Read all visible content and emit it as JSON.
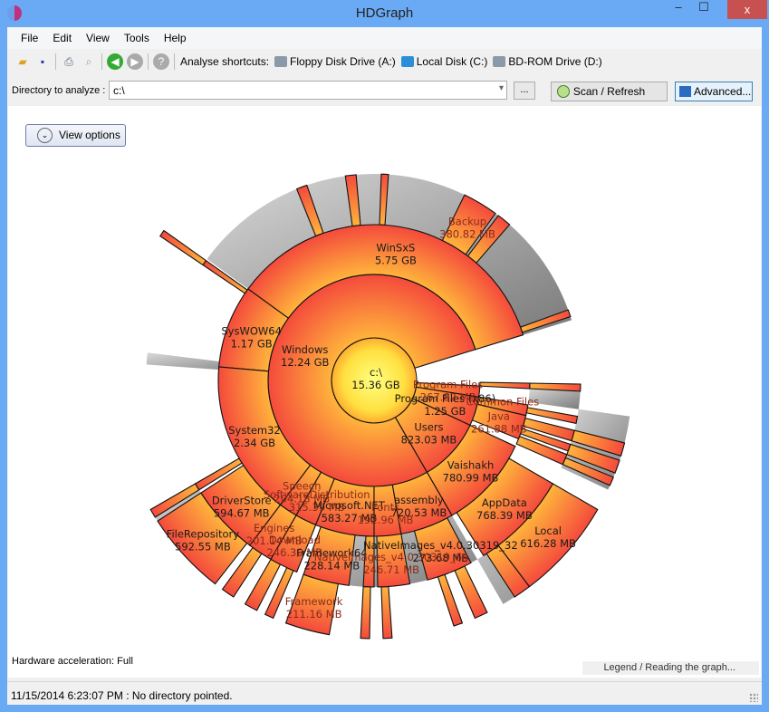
{
  "window": {
    "title": "HDGraph",
    "minimize": "‒",
    "maximize": "☐",
    "close": "x"
  },
  "menu": [
    "File",
    "Edit",
    "View",
    "Tools",
    "Help"
  ],
  "toolbar": {
    "icons": [
      "open-folder-icon",
      "save-icon",
      "print-icon",
      "print-preview-icon",
      "back-icon",
      "forward-icon",
      "help-icon"
    ],
    "shortcuts_label": "Analyse shortcuts:",
    "drives": [
      "Floppy Disk Drive (A:)",
      "Local Disk (C:)",
      "BD-ROM Drive (D:)"
    ]
  },
  "directory": {
    "label": "Directory to analyze :",
    "value": "c:\\",
    "browse": "...",
    "scan": "Scan / Refresh",
    "advanced": "Advanced..."
  },
  "view_options": "View options",
  "hardware": "Hardware acceleration: Full",
  "legend_link": "Legend / Reading the graph...",
  "status": "11/15/2014 6:23:07 PM : No directory pointed.",
  "colors": {
    "inner": "#ffff70",
    "mid": "#ffb43c",
    "outer": "#f44a3c",
    "shadow": "#9a9a9a",
    "titlebar": "#6aaaf4",
    "close": "#c75050"
  },
  "chart_data": {
    "type": "pie",
    "subtype": "sunburst",
    "nodes": [
      {
        "id": "root",
        "name": "c:\\",
        "size": "15.36 GB"
      },
      {
        "id": "windows",
        "parent": "root",
        "name": "Windows",
        "size": "12.24 GB"
      },
      {
        "id": "pf",
        "parent": "root",
        "name": "Program Files",
        "size": "267.82 MB"
      },
      {
        "id": "pfx86",
        "parent": "root",
        "name": "Program Files (x86)",
        "size": "1.25 GB"
      },
      {
        "id": "users",
        "parent": "root",
        "name": "Users",
        "size": "823.03 MB"
      },
      {
        "id": "winsxs",
        "parent": "windows",
        "name": "WinSxS",
        "size": "5.75 GB"
      },
      {
        "id": "syswow64",
        "parent": "windows",
        "name": "SysWOW64",
        "size": "1.17 GB"
      },
      {
        "id": "system32",
        "parent": "windows",
        "name": "System32",
        "size": "2.34 GB"
      },
      {
        "id": "speech",
        "parent": "windows",
        "name": "Speech",
        "size": "204.18 MB"
      },
      {
        "id": "softdist",
        "parent": "windows",
        "name": "SoftwareDistribution",
        "size": "315.39 MB"
      },
      {
        "id": "dotnet",
        "parent": "windows",
        "name": "Microsoft.NET",
        "size": "583.27 MB"
      },
      {
        "id": "fonts",
        "parent": "windows",
        "name": "Fonts",
        "size": "192.96 MB"
      },
      {
        "id": "assembly",
        "parent": "windows",
        "name": "assembly",
        "size": "720.53 MB"
      },
      {
        "id": "commonfiles",
        "parent": "pfx86",
        "name": "Common Files",
        "size": ""
      },
      {
        "id": "java",
        "parent": "pfx86",
        "name": "Java",
        "size": "261.88 MB"
      },
      {
        "id": "vaishakh",
        "parent": "users",
        "name": "Vaishakh",
        "size": "780.99 MB"
      },
      {
        "id": "appdata",
        "parent": "vaishakh",
        "name": "AppData",
        "size": "768.39 MB"
      },
      {
        "id": "local",
        "parent": "appdata",
        "name": "Local",
        "size": "616.28 MB"
      },
      {
        "id": "backup",
        "parent": "winsxs",
        "name": "Backup",
        "size": "380.82 MB"
      },
      {
        "id": "driverstore",
        "parent": "system32",
        "name": "DriverStore",
        "size": "594.67 MB"
      },
      {
        "id": "filerepo",
        "parent": "driverstore",
        "name": "FileRepository",
        "size": "592.55 MB"
      },
      {
        "id": "engines",
        "parent": "speech",
        "name": "Engines",
        "size": "201.14 MB"
      },
      {
        "id": "download",
        "parent": "softdist",
        "name": "Download",
        "size": "246.30 MB"
      },
      {
        "id": "framework64",
        "parent": "dotnet",
        "name": "Framework64",
        "size": "228.14 MB"
      },
      {
        "id": "framework",
        "parent": "dotnet",
        "name": "Framework",
        "size": "211.16 MB"
      },
      {
        "id": "ni32",
        "parent": "assembly",
        "name": "NativeImages_v4.0.30319_32",
        "size": "273.68 MB"
      },
      {
        "id": "ni64",
        "parent": "assembly",
        "name": "NativeImages_v4.0.30319_64",
        "size": "246.71 MB"
      }
    ]
  }
}
